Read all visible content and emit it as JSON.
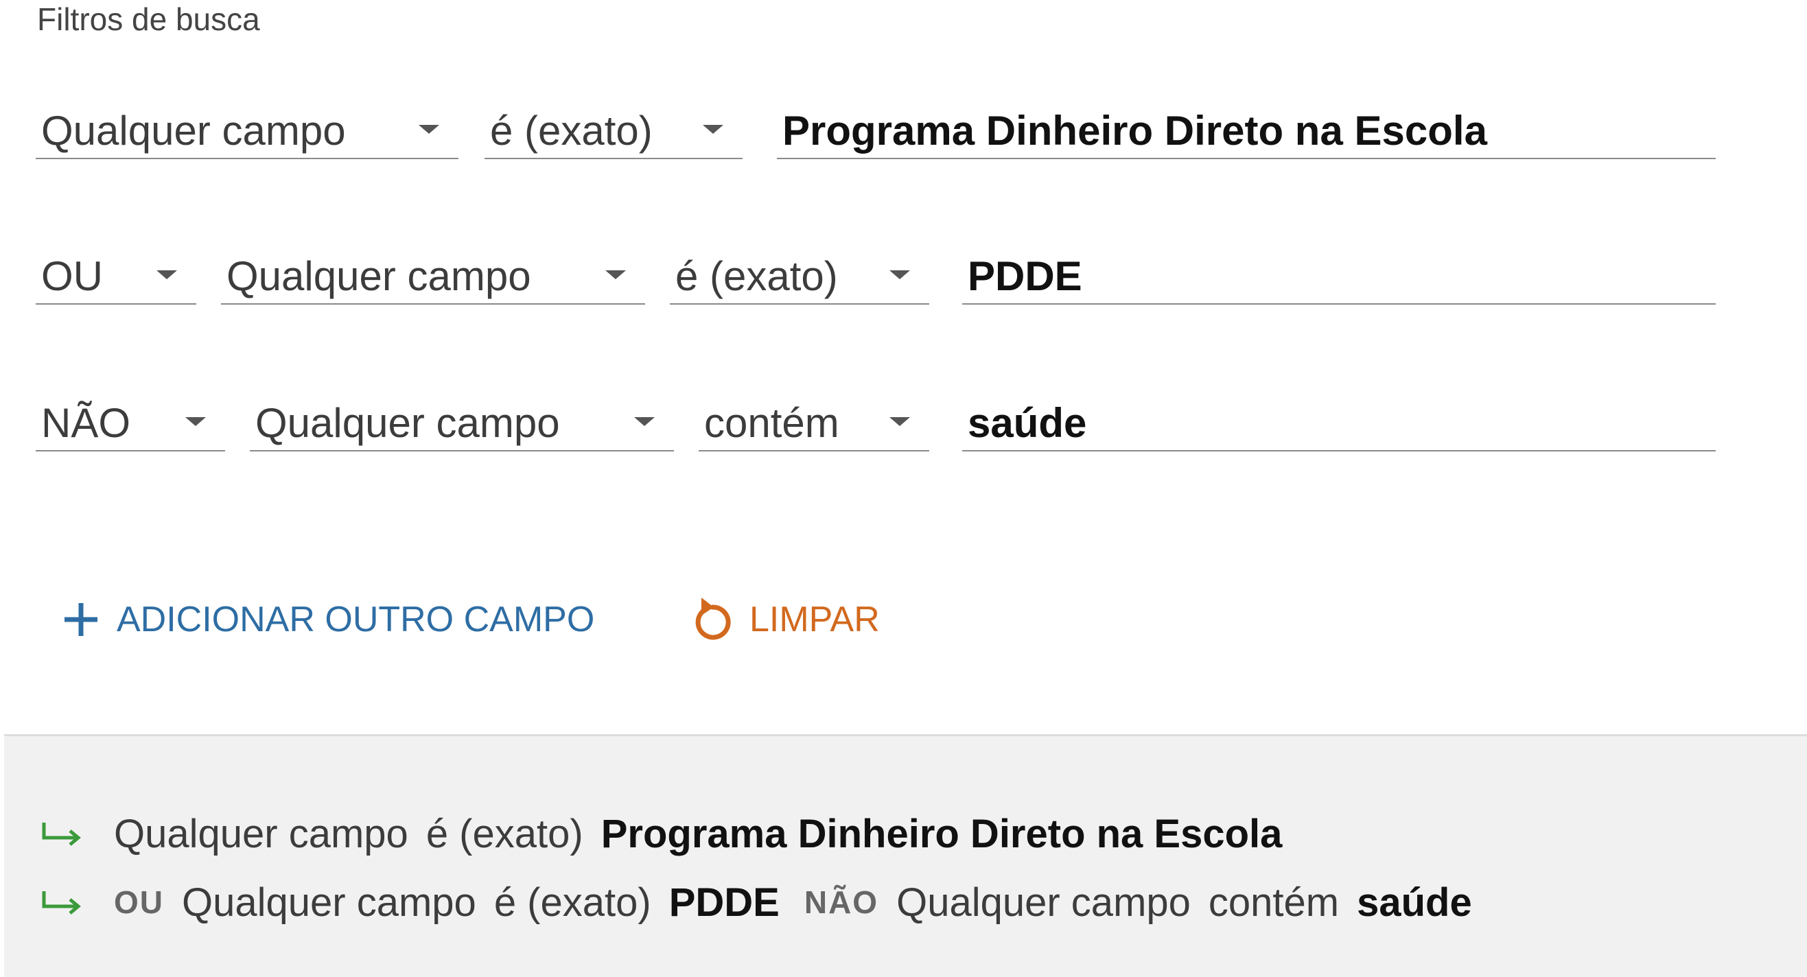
{
  "section_title": "Filtros de busca",
  "filters": [
    {
      "field": "Qualquer campo",
      "match": "é (exato)",
      "value": "Programa Dinheiro Direto na Escola"
    },
    {
      "operator": "OU",
      "field": "Qualquer campo",
      "match": "é (exato)",
      "value": "PDDE"
    },
    {
      "operator": "NÃO",
      "field": "Qualquer campo",
      "match": "contém",
      "value": "saúde"
    }
  ],
  "actions": {
    "add_label": "ADICIONAR OUTRO CAMPO",
    "clear_label": "LIMPAR",
    "add_color": "#2e6da4",
    "clear_color": "#d2691e"
  },
  "summary": {
    "line1": {
      "field": "Qualquer campo",
      "match": "é (exato)",
      "value": "Programa Dinheiro Direto na Escola"
    },
    "line2": [
      {
        "operator": "OU",
        "field": "Qualquer campo",
        "match": "é (exato)",
        "value": "PDDE"
      },
      {
        "operator": "NÃO",
        "field": "Qualquer campo",
        "match": "contém",
        "value": "saúde"
      }
    ],
    "arrow_color": "#3a9a3a"
  },
  "icons": {
    "add": "plus-icon",
    "clear": "undo-icon",
    "summary": "arrow-return-right-icon",
    "dropdown": "caret-down-icon"
  }
}
